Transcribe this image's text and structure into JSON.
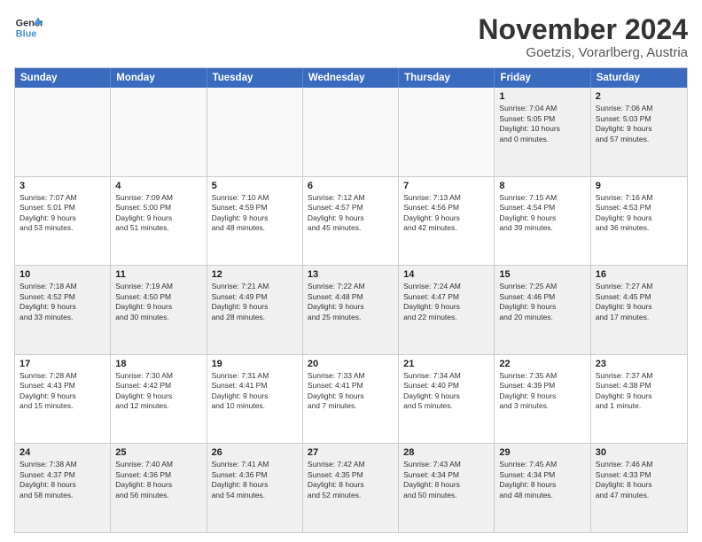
{
  "logo": {
    "line1": "General",
    "line2": "Blue"
  },
  "title": "November 2024",
  "subtitle": "Goetzis, Vorarlberg, Austria",
  "weekdays": [
    "Sunday",
    "Monday",
    "Tuesday",
    "Wednesday",
    "Thursday",
    "Friday",
    "Saturday"
  ],
  "weeks": [
    [
      {
        "day": "",
        "info": "",
        "empty": true
      },
      {
        "day": "",
        "info": "",
        "empty": true
      },
      {
        "day": "",
        "info": "",
        "empty": true
      },
      {
        "day": "",
        "info": "",
        "empty": true
      },
      {
        "day": "",
        "info": "",
        "empty": true
      },
      {
        "day": "1",
        "info": "Sunrise: 7:04 AM\nSunset: 5:05 PM\nDaylight: 10 hours\nand 0 minutes."
      },
      {
        "day": "2",
        "info": "Sunrise: 7:06 AM\nSunset: 5:03 PM\nDaylight: 9 hours\nand 57 minutes."
      }
    ],
    [
      {
        "day": "3",
        "info": "Sunrise: 7:07 AM\nSunset: 5:01 PM\nDaylight: 9 hours\nand 53 minutes."
      },
      {
        "day": "4",
        "info": "Sunrise: 7:09 AM\nSunset: 5:00 PM\nDaylight: 9 hours\nand 51 minutes."
      },
      {
        "day": "5",
        "info": "Sunrise: 7:10 AM\nSunset: 4:59 PM\nDaylight: 9 hours\nand 48 minutes."
      },
      {
        "day": "6",
        "info": "Sunrise: 7:12 AM\nSunset: 4:57 PM\nDaylight: 9 hours\nand 45 minutes."
      },
      {
        "day": "7",
        "info": "Sunrise: 7:13 AM\nSunset: 4:56 PM\nDaylight: 9 hours\nand 42 minutes."
      },
      {
        "day": "8",
        "info": "Sunrise: 7:15 AM\nSunset: 4:54 PM\nDaylight: 9 hours\nand 39 minutes."
      },
      {
        "day": "9",
        "info": "Sunrise: 7:16 AM\nSunset: 4:53 PM\nDaylight: 9 hours\nand 36 minutes."
      }
    ],
    [
      {
        "day": "10",
        "info": "Sunrise: 7:18 AM\nSunset: 4:52 PM\nDaylight: 9 hours\nand 33 minutes."
      },
      {
        "day": "11",
        "info": "Sunrise: 7:19 AM\nSunset: 4:50 PM\nDaylight: 9 hours\nand 30 minutes."
      },
      {
        "day": "12",
        "info": "Sunrise: 7:21 AM\nSunset: 4:49 PM\nDaylight: 9 hours\nand 28 minutes."
      },
      {
        "day": "13",
        "info": "Sunrise: 7:22 AM\nSunset: 4:48 PM\nDaylight: 9 hours\nand 25 minutes."
      },
      {
        "day": "14",
        "info": "Sunrise: 7:24 AM\nSunset: 4:47 PM\nDaylight: 9 hours\nand 22 minutes."
      },
      {
        "day": "15",
        "info": "Sunrise: 7:25 AM\nSunset: 4:46 PM\nDaylight: 9 hours\nand 20 minutes."
      },
      {
        "day": "16",
        "info": "Sunrise: 7:27 AM\nSunset: 4:45 PM\nDaylight: 9 hours\nand 17 minutes."
      }
    ],
    [
      {
        "day": "17",
        "info": "Sunrise: 7:28 AM\nSunset: 4:43 PM\nDaylight: 9 hours\nand 15 minutes."
      },
      {
        "day": "18",
        "info": "Sunrise: 7:30 AM\nSunset: 4:42 PM\nDaylight: 9 hours\nand 12 minutes."
      },
      {
        "day": "19",
        "info": "Sunrise: 7:31 AM\nSunset: 4:41 PM\nDaylight: 9 hours\nand 10 minutes."
      },
      {
        "day": "20",
        "info": "Sunrise: 7:33 AM\nSunset: 4:41 PM\nDaylight: 9 hours\nand 7 minutes."
      },
      {
        "day": "21",
        "info": "Sunrise: 7:34 AM\nSunset: 4:40 PM\nDaylight: 9 hours\nand 5 minutes."
      },
      {
        "day": "22",
        "info": "Sunrise: 7:35 AM\nSunset: 4:39 PM\nDaylight: 9 hours\nand 3 minutes."
      },
      {
        "day": "23",
        "info": "Sunrise: 7:37 AM\nSunset: 4:38 PM\nDaylight: 9 hours\nand 1 minute."
      }
    ],
    [
      {
        "day": "24",
        "info": "Sunrise: 7:38 AM\nSunset: 4:37 PM\nDaylight: 8 hours\nand 58 minutes."
      },
      {
        "day": "25",
        "info": "Sunrise: 7:40 AM\nSunset: 4:36 PM\nDaylight: 8 hours\nand 56 minutes."
      },
      {
        "day": "26",
        "info": "Sunrise: 7:41 AM\nSunset: 4:36 PM\nDaylight: 8 hours\nand 54 minutes."
      },
      {
        "day": "27",
        "info": "Sunrise: 7:42 AM\nSunset: 4:35 PM\nDaylight: 8 hours\nand 52 minutes."
      },
      {
        "day": "28",
        "info": "Sunrise: 7:43 AM\nSunset: 4:34 PM\nDaylight: 8 hours\nand 50 minutes."
      },
      {
        "day": "29",
        "info": "Sunrise: 7:45 AM\nSunset: 4:34 PM\nDaylight: 8 hours\nand 48 minutes."
      },
      {
        "day": "30",
        "info": "Sunrise: 7:46 AM\nSunset: 4:33 PM\nDaylight: 8 hours\nand 47 minutes."
      }
    ]
  ]
}
